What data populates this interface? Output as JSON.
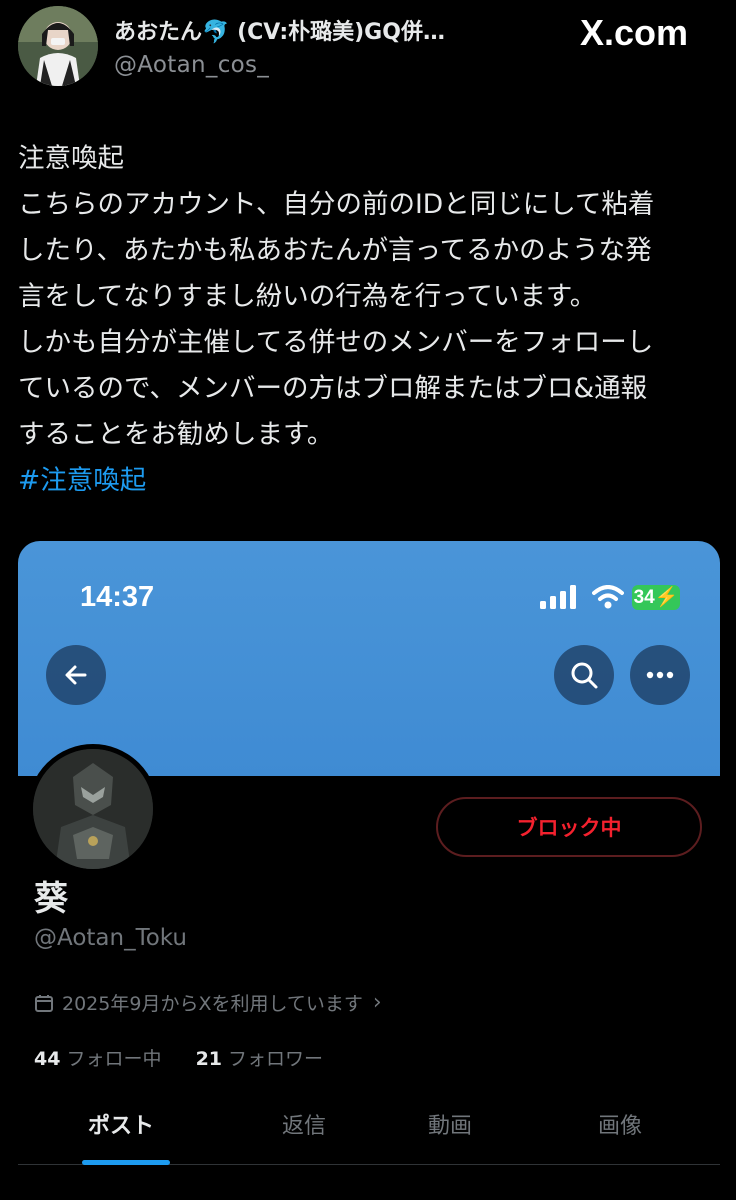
{
  "header": {
    "display_name": "あおたん",
    "display_name_suffix": "(CV:朴璐美)GQ併…",
    "handle": "@Aotan_cos_",
    "site_label": "X.com",
    "dolphin_icon": "dolphin-emoji"
  },
  "tweet": {
    "lines": [
      "注意喚起",
      "こちらのアカウント、自分の前のIDと同じにして粘着",
      "したり、あたかも私あおたんが言ってるかのような発",
      "言をしてなりすまし紛いの行為を行っています。",
      "しかも自分が主催してる併せのメンバーをフォローし",
      "ているので、メンバーの方はブロ解またはブロ&通報",
      "することをお勧めします。"
    ],
    "hashtag": "#注意喚起"
  },
  "screenshot": {
    "status_time": "14:37",
    "battery": "34",
    "profile": {
      "display_name": "葵",
      "handle": "@Aotan_Toku",
      "joined": "2025年9月からXを利用しています",
      "following_count": "44",
      "following_label": "フォロー中",
      "followers_count": "21",
      "followers_label": "フォロワー",
      "block_label": "ブロック中"
    },
    "tabs": [
      "ポスト",
      "返信",
      "動画",
      "画像"
    ]
  },
  "colors": {
    "background": "#000000",
    "accent": "#1d9bf0",
    "banner": "#4a95d8",
    "block_red": "#f4212e",
    "muted": "#71767b"
  }
}
